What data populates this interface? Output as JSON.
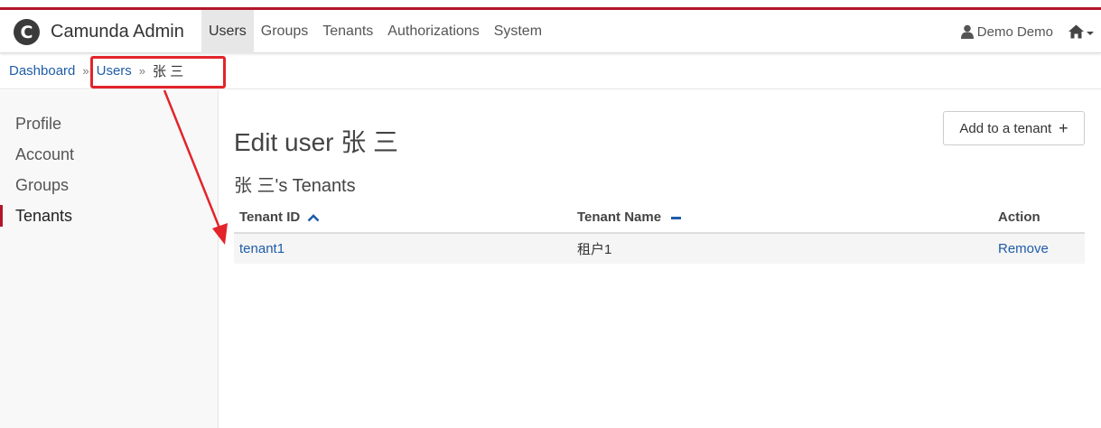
{
  "app": {
    "brand_letter": "C",
    "brand_name": "Camunda Admin"
  },
  "nav": {
    "items": [
      "Users",
      "Groups",
      "Tenants",
      "Authorizations",
      "System"
    ],
    "user": "Demo Demo"
  },
  "breadcrumb": {
    "dashboard": "Dashboard",
    "sep": "»",
    "users": "Users",
    "current": "张 三"
  },
  "sidebar": {
    "items": [
      "Profile",
      "Account",
      "Groups",
      "Tenants"
    ]
  },
  "main": {
    "title": "Edit user 张 三",
    "add_button": "Add to a tenant",
    "add_button_icon": "+",
    "section_title": "张 三's Tenants",
    "table": {
      "headers": [
        "Tenant ID",
        "Tenant Name",
        "Action"
      ],
      "rows": [
        {
          "id": "tenant1",
          "name": "租户1",
          "action": "Remove"
        }
      ]
    }
  },
  "colors": {
    "accent": "#b5152b",
    "link": "#1f5ca8",
    "annotation": "#e3242b"
  },
  "icons": [
    "camunda-logo-icon",
    "user-icon",
    "home-icon",
    "sort-ascending-icon",
    "sort-none-icon",
    "plus-icon",
    "annotation-arrow"
  ]
}
